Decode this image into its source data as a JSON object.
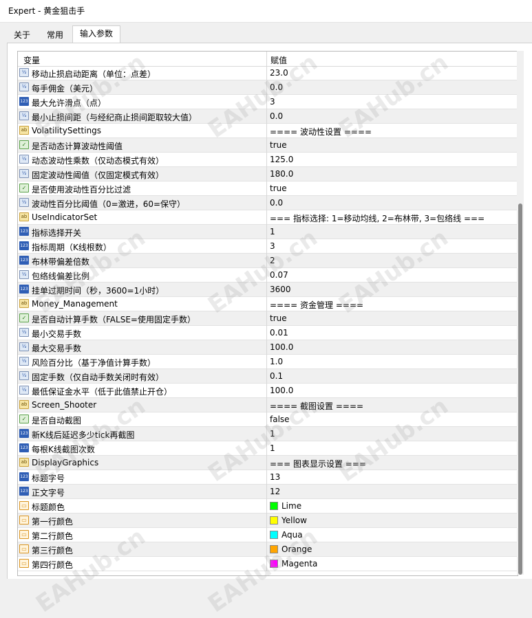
{
  "window": {
    "title": "Expert - 黄金狙击手"
  },
  "tabs": [
    {
      "label": "关于"
    },
    {
      "label": "常用"
    },
    {
      "label": "输入参数"
    }
  ],
  "table": {
    "headers": {
      "variable": "变量",
      "value": "赋值"
    },
    "rows": [
      {
        "type": "dbl",
        "icon": "double-icon",
        "name": "移动止损启动距离（单位：点差）",
        "value": "23.0"
      },
      {
        "type": "dbl",
        "icon": "double-icon",
        "name": "每手佣金（美元）",
        "value": "0.0"
      },
      {
        "type": "int",
        "icon": "integer-icon",
        "name": "最大允许滑点（点）",
        "value": "3"
      },
      {
        "type": "dbl",
        "icon": "double-icon",
        "name": "最小止损间距（与经纪商止损间距取较大值）",
        "value": "0.0"
      },
      {
        "type": "str",
        "icon": "string-icon",
        "name": "VolatilitySettings",
        "value": "==== 波动性设置 ===="
      },
      {
        "type": "bool",
        "icon": "bool-icon",
        "name": "是否动态计算波动性阈值",
        "value": "true"
      },
      {
        "type": "dbl",
        "icon": "double-icon",
        "name": "动态波动性乘数（仅动态模式有效）",
        "value": "125.0"
      },
      {
        "type": "dbl",
        "icon": "double-icon",
        "name": "固定波动性阈值（仅固定模式有效）",
        "value": "180.0"
      },
      {
        "type": "bool",
        "icon": "bool-icon",
        "name": "是否使用波动性百分比过滤",
        "value": "true"
      },
      {
        "type": "dbl",
        "icon": "double-icon",
        "name": "波动性百分比阈值（0=激进，60=保守）",
        "value": "0.0"
      },
      {
        "type": "str",
        "icon": "string-icon",
        "name": "UseIndicatorSet",
        "value": "=== 指标选择: 1=移动均线, 2=布林带, 3=包络线 ==="
      },
      {
        "type": "int",
        "icon": "integer-icon",
        "name": "指标选择开关",
        "value": "1"
      },
      {
        "type": "int",
        "icon": "integer-icon",
        "name": "指标周期（K线根数）",
        "value": "3"
      },
      {
        "type": "int",
        "icon": "integer-icon",
        "name": "布林带偏差倍数",
        "value": "2"
      },
      {
        "type": "dbl",
        "icon": "double-icon",
        "name": "包络线偏差比例",
        "value": "0.07"
      },
      {
        "type": "int",
        "icon": "integer-icon",
        "name": "挂单过期时间（秒，3600=1小时）",
        "value": "3600"
      },
      {
        "type": "str",
        "icon": "string-icon",
        "name": "Money_Management",
        "value": "==== 资金管理 ===="
      },
      {
        "type": "bool",
        "icon": "bool-icon",
        "name": "是否自动计算手数（FALSE=使用固定手数）",
        "value": "true"
      },
      {
        "type": "dbl",
        "icon": "double-icon",
        "name": "最小交易手数",
        "value": "0.01"
      },
      {
        "type": "dbl",
        "icon": "double-icon",
        "name": "最大交易手数",
        "value": "100.0"
      },
      {
        "type": "dbl",
        "icon": "double-icon",
        "name": "风险百分比（基于净值计算手数）",
        "value": "1.0"
      },
      {
        "type": "dbl",
        "icon": "double-icon",
        "name": "固定手数（仅自动手数关闭时有效）",
        "value": "0.1"
      },
      {
        "type": "dbl",
        "icon": "double-icon",
        "name": "最低保证金水平（低于此值禁止开仓）",
        "value": "100.0"
      },
      {
        "type": "str",
        "icon": "string-icon",
        "name": "Screen_Shooter",
        "value": "==== 截图设置 ===="
      },
      {
        "type": "bool",
        "icon": "bool-icon",
        "name": "是否自动截图",
        "value": "false"
      },
      {
        "type": "int",
        "icon": "integer-icon",
        "name": "新K线后延迟多少tick再截图",
        "value": "1"
      },
      {
        "type": "int",
        "icon": "integer-icon",
        "name": "每根K线截图次数",
        "value": "1"
      },
      {
        "type": "str",
        "icon": "string-icon",
        "name": "DisplayGraphics",
        "value": "=== 图表显示设置 ==="
      },
      {
        "type": "int",
        "icon": "integer-icon",
        "name": "标题字号",
        "value": "13"
      },
      {
        "type": "int",
        "icon": "integer-icon",
        "name": "正文字号",
        "value": "12"
      },
      {
        "type": "col",
        "icon": "color-icon",
        "name": "标题颜色",
        "value": "Lime",
        "color": "#00ff00"
      },
      {
        "type": "col",
        "icon": "color-icon",
        "name": "第一行颜色",
        "value": "Yellow",
        "color": "#ffff00"
      },
      {
        "type": "col",
        "icon": "color-icon",
        "name": "第二行颜色",
        "value": "Aqua",
        "color": "#00ffff"
      },
      {
        "type": "col",
        "icon": "color-icon",
        "name": "第三行颜色",
        "value": "Orange",
        "color": "#ffa500"
      },
      {
        "type": "col",
        "icon": "color-icon",
        "name": "第四行颜色",
        "value": "Magenta",
        "color": "#ff00ff"
      }
    ]
  },
  "watermark": {
    "text": "EAHub.cn"
  }
}
